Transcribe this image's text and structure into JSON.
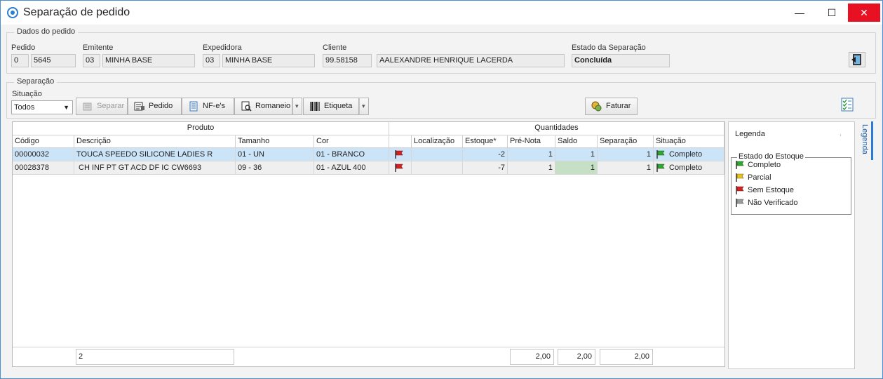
{
  "window": {
    "title": "Separação de pedido",
    "min_glyph": "—",
    "max_glyph": "☐",
    "close_glyph": "✕"
  },
  "dados": {
    "caption": "Dados do pedido",
    "pedido_label": "Pedido",
    "pedido_a": "0",
    "pedido_b": "5645",
    "emitente_label": "Emitente",
    "emitente_code": "03",
    "emitente_name": "MINHA BASE",
    "expedidora_label": "Expedidora",
    "expedidora_code": "03",
    "expedidora_name": "MINHA BASE",
    "cliente_label": "Cliente",
    "cliente_code": "99.58158",
    "cliente_name": "AALEXANDRE  HENRIQUE  LACERDA",
    "estado_label": "Estado da Separação",
    "estado_value": "Concluída"
  },
  "separacao": {
    "caption": "Separação",
    "situacao_label": "Situação",
    "situacao_selected": "Todos",
    "buttons": {
      "separar": "Separar",
      "pedido": "Pedido",
      "nfes": "NF-e's",
      "romaneio": "Romaneio",
      "etiqueta": "Etiqueta",
      "faturar": "Faturar"
    }
  },
  "grid": {
    "group_produto": "Produto",
    "group_quantidades": "Quantidades",
    "columns": [
      "Código",
      "Descrição",
      "Tamanho",
      "Cor",
      "",
      "Localização",
      "Estoque*",
      "Pré-Nota",
      "Saldo",
      "Separação",
      "Situação"
    ],
    "rows": [
      {
        "codigo": "00000032",
        "descricao": "TOUCA SPEEDO SILICONE LADIES R",
        "tamanho": "01 - UN",
        "cor": "01 - BRANCO",
        "flag": "red",
        "localizacao": "",
        "estoque": "-2",
        "pre_nota": "1",
        "saldo": "1",
        "separacao": "1",
        "situacao": "Completo",
        "situacao_flag": "green"
      },
      {
        "codigo": "00028378",
        "descricao": " CH INF PT GT ACD DF IC CW6693",
        "tamanho": "09 - 36",
        "cor": "01 - AZUL 400",
        "flag": "red",
        "localizacao": "",
        "estoque": "-7",
        "pre_nota": "1",
        "saldo": "1",
        "separacao": "1",
        "situacao": "Completo",
        "situacao_flag": "green"
      }
    ],
    "footer": {
      "count": "2",
      "pre_nota_total": "2,00",
      "saldo_total": "2,00",
      "separacao_total": "2,00"
    }
  },
  "legend": {
    "title": "Legenda",
    "tab_label": "Legenda",
    "box_caption": "Estado do Estoque",
    "items": [
      {
        "label": "Completo",
        "color": "#2fa82f"
      },
      {
        "label": "Parcial",
        "color": "#e8c21a"
      },
      {
        "label": "Sem Estoque",
        "color": "#d42121"
      },
      {
        "label": "Não Verificado",
        "color": "#9a9a9a"
      }
    ]
  },
  "colors": {
    "accent": "#2c7dd1",
    "close": "#e81123",
    "selected_row": "#cce4f7",
    "saldo_highlight": "#c6e0c6"
  },
  "icons": [
    "app-icon",
    "minimize-icon",
    "maximize-icon",
    "close-icon",
    "exit-door-icon",
    "checklist-icon",
    "separar-icon",
    "pedido-icon",
    "nfe-icon",
    "romaneio-icon",
    "barcode-icon",
    "faturar-coins-icon",
    "pin-icon",
    "flag-icon"
  ]
}
